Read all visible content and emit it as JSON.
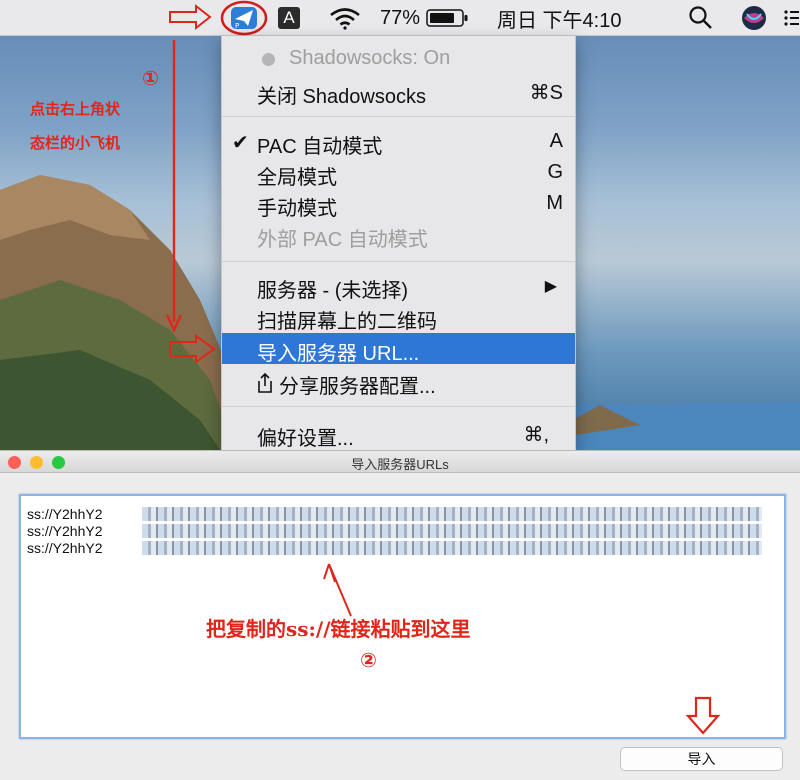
{
  "menubar": {
    "input_source": "A",
    "battery_percent": "77%",
    "clock": "周日 下午4:10"
  },
  "menu": {
    "status": "Shadowsocks: On",
    "toggle_label": "关闭 Shadowsocks",
    "toggle_shortcut": "⌘S",
    "pac_mode": "PAC 自动模式",
    "pac_shortcut": "A",
    "global_mode": "全局模式",
    "global_shortcut": "G",
    "manual_mode": "手动模式",
    "manual_shortcut": "M",
    "external_pac": "外部 PAC 自动模式",
    "servers": "服务器 - (未选择)",
    "servers_arrow": "▶",
    "scan_qr": "扫描屏幕上的二维码",
    "import_url": "导入服务器 URL...",
    "share_config": "分享服务器配置...",
    "preferences": "偏好设置...",
    "preferences_shortcut": "⌘,"
  },
  "annotations": {
    "step1_num": "①",
    "step1_line1": "点击右上角状",
    "step1_line2": "态栏的小飞机",
    "step2_text": "把复制的ss://链接粘贴到这里",
    "step2_num": "②"
  },
  "dialog": {
    "title": "导入服务器URLs",
    "url_lines": [
      "ss://Y2hhY2",
      "ss://Y2hhY2",
      "ss://Y2hhY2"
    ],
    "import_button": "导入"
  },
  "colors": {
    "menu_highlight": "#2f77d6",
    "annotation_red": "#e0261a",
    "traffic_close": "#ff5f57",
    "traffic_minimize": "#febc2e",
    "traffic_zoom": "#28c840"
  }
}
